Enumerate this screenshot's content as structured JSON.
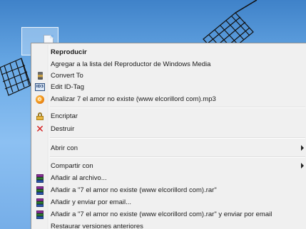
{
  "desktop": {
    "icon_name": "mp3-file-icon"
  },
  "menu": {
    "items": [
      {
        "label": "Reproducir",
        "icon": "none",
        "bold": true
      },
      {
        "label": "Agregar a la lista del Reproductor de Windows Media",
        "icon": "none"
      },
      {
        "label": "Convert To",
        "icon": "convert-icon"
      },
      {
        "label": "Edit ID-Tag",
        "icon": "id3-tag-icon"
      },
      {
        "label": "Analizar 7 el amor no existe (www elcorillord com).mp3",
        "icon": "analyze-icon"
      },
      {
        "label": "Encriptar",
        "icon": "lock-icon"
      },
      {
        "label": "Destruir",
        "icon": "destroy-x-icon"
      },
      {
        "label": "Abrir con",
        "icon": "none",
        "submenu": true
      },
      {
        "label": "Compartir con",
        "icon": "none",
        "submenu": true
      },
      {
        "label": "Añadir al archivo...",
        "icon": "winrar-icon"
      },
      {
        "label": "Añadir a \"7 el amor no existe (www elcorillord com).rar\"",
        "icon": "winrar-icon"
      },
      {
        "label": "Añadir y enviar por email...",
        "icon": "winrar-icon"
      },
      {
        "label": "Añadir a \"7 el amor no existe (www elcorillord com).rar\" y enviar por email",
        "icon": "winrar-icon"
      },
      {
        "label": "Restaurar versiones anteriores",
        "icon": "none"
      }
    ]
  },
  "colors": {
    "menu_background": "#f0f0f0",
    "desktop_blue": "#6aaae6",
    "destroy_red": "#d51a1a"
  }
}
